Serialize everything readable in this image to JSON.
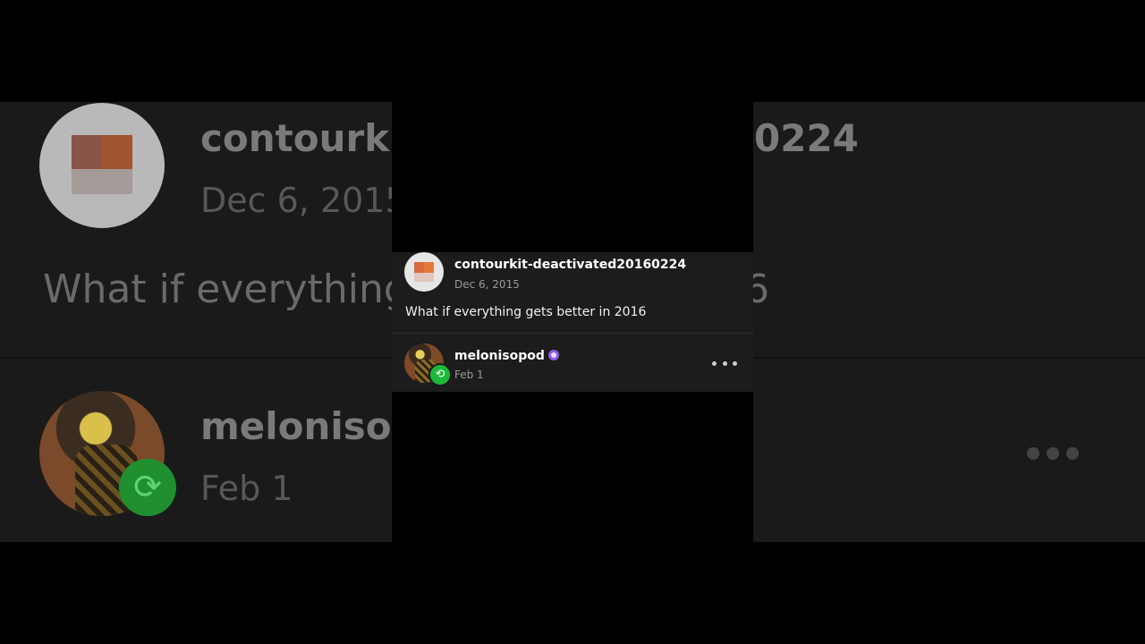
{
  "background": {
    "name1_start": "contourki",
    "name1_end": "0224",
    "date1": "Dec 6, 2015",
    "body_start": "What if everything",
    "body_end": "6",
    "name2": "melonisop",
    "date2": "Feb 1"
  },
  "original_post": {
    "username": "contourkit-deactivated20160224",
    "date": "Dec 6, 2015",
    "body": "What if everything gets better in 2016"
  },
  "reblog": {
    "username": "melonisopod",
    "date": "Feb 1"
  },
  "colors": {
    "reblog_green": "#1db83a",
    "badge_purple": "#8f5ce6",
    "card_bg": "#1c1c1c"
  }
}
